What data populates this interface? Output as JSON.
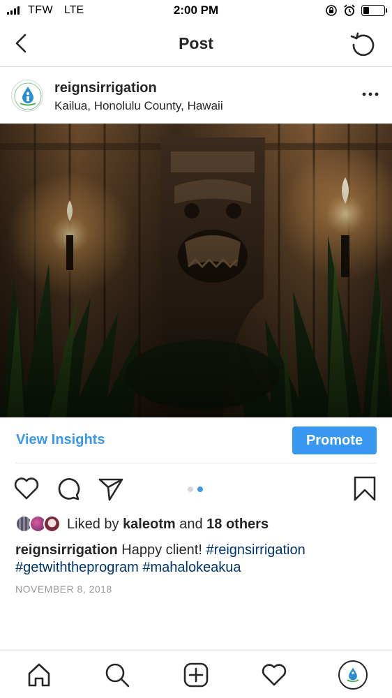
{
  "status_bar": {
    "carrier": "TFW",
    "network": "LTE",
    "time": "2:00 PM"
  },
  "nav": {
    "title": "Post",
    "back_icon": "chevron-left-icon",
    "refresh_icon": "refresh-icon"
  },
  "post": {
    "username": "reignsirrigation",
    "location": "Kailua, Honolulu County, Hawaii",
    "more_icon": "ellipsis-icon",
    "photo_description_icon": "photo"
  },
  "insights": {
    "view_label": "View Insights",
    "promote_label": "Promote",
    "accent": "#3897f0"
  },
  "actions": {
    "like_icon": "heart-icon",
    "comment_icon": "comment-icon",
    "share_icon": "send-icon",
    "save_icon": "bookmark-icon",
    "carousel_current": 2,
    "carousel_total": 2
  },
  "likes": {
    "prefix": "Liked by",
    "user": "kaleotm",
    "middle": "and",
    "others": "18 others"
  },
  "caption": {
    "username": "reignsirrigation",
    "text": "Happy client!",
    "tag1": "#reignsirrigation",
    "tag2": "#getwiththeprogram",
    "tag3": "#mahalokeakua",
    "link_color": "#003569"
  },
  "date": "NOVEMBER 8, 2018",
  "tab_bar": {
    "home_icon": "home-icon",
    "search_icon": "search-icon",
    "add_icon": "add-post-icon",
    "activity_icon": "heart-icon",
    "profile_icon": "profile-avatar"
  }
}
